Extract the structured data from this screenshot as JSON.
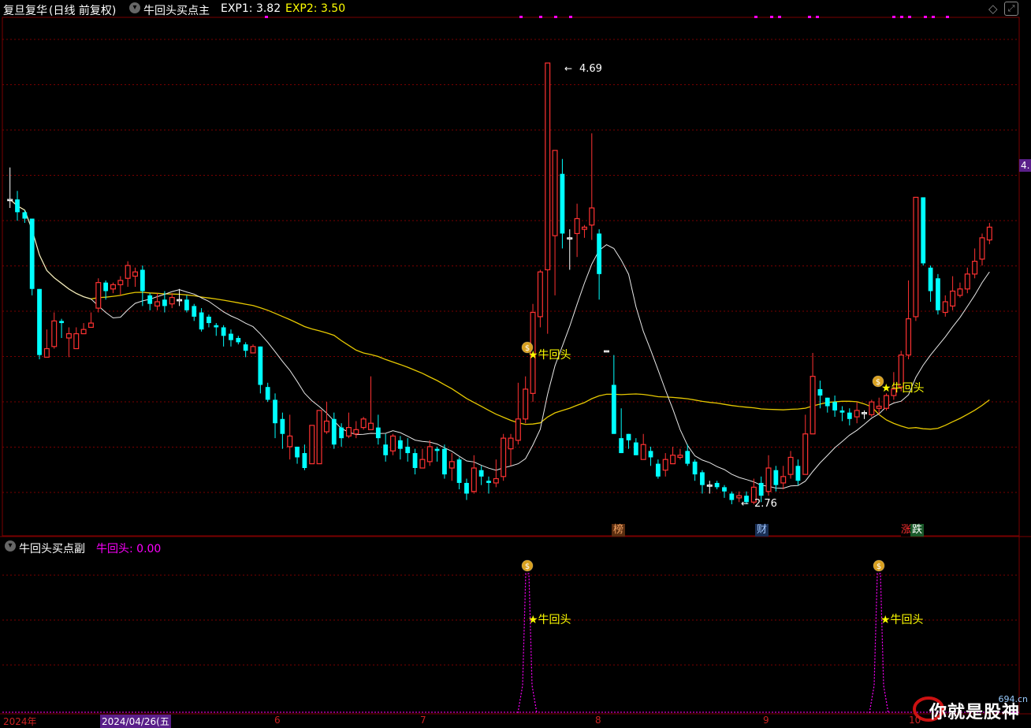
{
  "main_panel": {
    "stock_name": "复旦复华",
    "period_label": "(日线 前复权)",
    "indicator_name": "牛回头买点主",
    "exp1_label": "EXP1: 3.82",
    "exp2_label": "EXP2: 3.50",
    "price_tag": "4.",
    "high_label": "4.69",
    "low_label": "2.76",
    "signal_label": "★牛回头",
    "news_tags": [
      {
        "text": "榜",
        "color": "#d27a3c"
      },
      {
        "text": "财",
        "color": "#5a8ad8"
      },
      {
        "text": "涨",
        "color": "#cc2222"
      },
      {
        "text": "跌",
        "color": "#22aa44"
      }
    ]
  },
  "sub_panel": {
    "indicator_name": "牛回头买点副",
    "value_label": "牛回头: 0.00",
    "signal_label": "★牛回头"
  },
  "x_axis": {
    "labels": [
      "2024年",
      "2024/04/26(五",
      "6",
      "7",
      "8",
      "9",
      "10"
    ]
  },
  "watermark": {
    "text": "你就是股神",
    "site": "694.cn"
  },
  "colors": {
    "up": "#ff3232",
    "down": "#00ffff",
    "ma_short": "#e8e8e8",
    "ma_long": "#e6c800",
    "signal": "#ffff00",
    "magenta": "#ff00ff",
    "grid": "#7a0000"
  },
  "chart_data": {
    "type": "candlestick",
    "y_axis_visible": false,
    "price_high": 4.69,
    "price_low": 2.76,
    "series": [
      {
        "name": "EXP1",
        "last_value": 3.82
      },
      {
        "name": "EXP2",
        "last_value": 3.5
      }
    ],
    "ohlc": [
      [
        4.05,
        4.05,
        4.2,
        4.01
      ],
      [
        4.05,
        3.99,
        4.09,
        3.95
      ],
      [
        3.99,
        3.96,
        4.0,
        3.94
      ],
      [
        3.96,
        3.63,
        3.96,
        3.6
      ],
      [
        3.63,
        3.32,
        3.63,
        3.3
      ],
      [
        3.31,
        3.35,
        3.44,
        3.33
      ],
      [
        3.36,
        3.48,
        3.52,
        3.35
      ],
      [
        3.48,
        3.47,
        3.49,
        3.4
      ],
      [
        3.4,
        3.42,
        3.45,
        3.31
      ],
      [
        3.35,
        3.42,
        3.45,
        3.35
      ],
      [
        3.42,
        3.44,
        3.47,
        3.42
      ],
      [
        3.45,
        3.47,
        3.52,
        3.45
      ],
      [
        3.54,
        3.66,
        3.68,
        3.52
      ],
      [
        3.66,
        3.62,
        3.67,
        3.58
      ],
      [
        3.63,
        3.65,
        3.66,
        3.61
      ],
      [
        3.65,
        3.67,
        3.69,
        3.6
      ],
      [
        3.68,
        3.74,
        3.76,
        3.64
      ],
      [
        3.69,
        3.71,
        3.73,
        3.64
      ],
      [
        3.72,
        3.62,
        3.74,
        3.55
      ],
      [
        3.6,
        3.56,
        3.61,
        3.53
      ],
      [
        3.55,
        3.57,
        3.61,
        3.53
      ],
      [
        3.58,
        3.55,
        3.62,
        3.52
      ],
      [
        3.56,
        3.59,
        3.61,
        3.54
      ],
      [
        3.58,
        3.58,
        3.63,
        3.55
      ],
      [
        3.58,
        3.53,
        3.6,
        3.52
      ],
      [
        3.55,
        3.5,
        3.56,
        3.48
      ],
      [
        3.52,
        3.44,
        3.54,
        3.43
      ],
      [
        3.5,
        3.47,
        3.51,
        3.45
      ],
      [
        3.46,
        3.45,
        3.47,
        3.41
      ],
      [
        3.45,
        3.41,
        3.46,
        3.36
      ],
      [
        3.42,
        3.39,
        3.44,
        3.36
      ],
      [
        3.4,
        3.38,
        3.41,
        3.37
      ],
      [
        3.37,
        3.34,
        3.38,
        3.31
      ],
      [
        3.33,
        3.36,
        3.37,
        3.33
      ],
      [
        3.36,
        3.18,
        3.36,
        3.14
      ],
      [
        3.17,
        3.11,
        3.19,
        3.1
      ],
      [
        3.11,
        3.0,
        3.14,
        2.93
      ],
      [
        3.02,
        2.95,
        3.05,
        2.88
      ],
      [
        2.89,
        2.94,
        3.04,
        2.83
      ],
      [
        2.89,
        2.84,
        2.89,
        2.81
      ],
      [
        2.86,
        2.79,
        2.9,
        2.78
      ],
      [
        2.81,
        2.99,
        2.96,
        2.99
      ],
      [
        2.81,
        3.06,
        3.04,
        3.06
      ],
      [
        2.96,
        3.01,
        3.1,
        2.95
      ],
      [
        3.02,
        2.9,
        3.05,
        2.88
      ],
      [
        2.98,
        2.93,
        3.0,
        2.89
      ],
      [
        2.94,
        2.98,
        3.05,
        2.93
      ],
      [
        2.95,
        2.97,
        3.01,
        2.93
      ],
      [
        2.98,
        3.02,
        3.03,
        2.97
      ],
      [
        2.97,
        3.0,
        3.22,
        2.97
      ],
      [
        2.98,
        2.93,
        3.04,
        2.9
      ],
      [
        2.9,
        2.85,
        2.95,
        2.82
      ],
      [
        2.87,
        2.94,
        2.95,
        2.85
      ],
      [
        2.92,
        2.88,
        2.94,
        2.83
      ],
      [
        2.89,
        2.86,
        2.93,
        2.82
      ],
      [
        2.86,
        2.79,
        2.88,
        2.76
      ],
      [
        2.79,
        2.83,
        2.88,
        2.79
      ],
      [
        2.82,
        2.89,
        2.92,
        2.8
      ],
      [
        2.88,
        2.87,
        2.89,
        2.82
      ],
      [
        2.88,
        2.76,
        2.9,
        2.74
      ],
      [
        2.79,
        2.82,
        2.86,
        2.73
      ],
      [
        2.83,
        2.72,
        2.84,
        2.69
      ],
      [
        2.72,
        2.67,
        2.74,
        2.64
      ],
      [
        2.68,
        2.79,
        2.85,
        2.67
      ],
      [
        2.78,
        2.75,
        2.8,
        2.71
      ],
      [
        2.73,
        2.72,
        2.75,
        2.67
      ],
      [
        2.72,
        2.74,
        2.83,
        2.7
      ],
      [
        2.75,
        2.93,
        2.95,
        2.73
      ],
      [
        2.88,
        2.93,
        2.95,
        2.8
      ],
      [
        2.92,
        3.02,
        3.19,
        2.9
      ],
      [
        3.02,
        3.16,
        3.22,
        3.0
      ],
      [
        3.14,
        3.52,
        3.56,
        3.1
      ],
      [
        3.5,
        3.71,
        3.72,
        3.45
      ],
      [
        3.72,
        4.69,
        4.69,
        3.42
      ],
      [
        3.88,
        4.28,
        4.28,
        3.6
      ],
      [
        4.17,
        3.89,
        4.24,
        3.82
      ],
      [
        3.87,
        3.87,
        3.91,
        3.72
      ],
      [
        3.89,
        3.96,
        4.03,
        3.78
      ],
      [
        3.91,
        3.92,
        3.93,
        3.87
      ],
      [
        3.93,
        4.01,
        4.36,
        3.86
      ],
      [
        3.89,
        3.7,
        3.91,
        3.58
      ],
      [
        3.34,
        3.34,
        3.34,
        3.34
      ],
      [
        3.18,
        2.95,
        3.32,
        2.95
      ],
      [
        2.93,
        2.86,
        3.07,
        2.86
      ],
      [
        2.95,
        2.92,
        2.95,
        2.88
      ],
      [
        2.91,
        2.85,
        2.93,
        2.85
      ],
      [
        2.83,
        2.9,
        2.95,
        2.83
      ],
      [
        2.87,
        2.84,
        2.89,
        2.8
      ],
      [
        2.81,
        2.75,
        2.83,
        2.74
      ],
      [
        2.78,
        2.83,
        2.86,
        2.75
      ],
      [
        2.81,
        2.85,
        2.89,
        2.81
      ],
      [
        2.84,
        2.85,
        2.88,
        2.83
      ],
      [
        2.87,
        2.81,
        2.9,
        2.8
      ],
      [
        2.82,
        2.76,
        2.83,
        2.73
      ],
      [
        2.77,
        2.71,
        2.78,
        2.67
      ],
      [
        2.71,
        2.71,
        2.73,
        2.67
      ],
      [
        2.72,
        2.7,
        2.73,
        2.69
      ],
      [
        2.7,
        2.68,
        2.71,
        2.65
      ],
      [
        2.67,
        2.64,
        2.68,
        2.62
      ],
      [
        2.65,
        2.66,
        2.68,
        2.63
      ],
      [
        2.66,
        2.63,
        2.68,
        2.62
      ],
      [
        2.63,
        2.7,
        2.74,
        2.62
      ],
      [
        2.72,
        2.66,
        2.75,
        2.63
      ],
      [
        2.68,
        2.79,
        2.85,
        2.66
      ],
      [
        2.78,
        2.71,
        2.8,
        2.68
      ],
      [
        2.72,
        2.75,
        2.8,
        2.69
      ],
      [
        2.76,
        2.84,
        2.87,
        2.74
      ],
      [
        2.8,
        2.73,
        2.83,
        2.71
      ],
      [
        2.76,
        2.95,
        3.04,
        2.76
      ],
      [
        2.95,
        3.22,
        3.33,
        2.95
      ],
      [
        3.16,
        3.13,
        3.2,
        3.07
      ],
      [
        3.12,
        3.08,
        3.12,
        3.05
      ],
      [
        3.1,
        3.06,
        3.13,
        3.03
      ],
      [
        3.06,
        3.05,
        3.08,
        3.01
      ],
      [
        3.05,
        3.02,
        3.07,
        2.99
      ],
      [
        3.03,
        3.06,
        3.1,
        3.0
      ],
      [
        3.05,
        3.05,
        3.06,
        3.02
      ],
      [
        3.04,
        3.1,
        3.11,
        3.03
      ],
      [
        3.07,
        3.08,
        3.12,
        3.04
      ],
      [
        3.07,
        3.13,
        3.14,
        3.06
      ],
      [
        3.13,
        3.16,
        3.24,
        3.11
      ],
      [
        3.17,
        3.32,
        3.34,
        3.15
      ],
      [
        3.32,
        3.49,
        3.67,
        3.3
      ],
      [
        3.5,
        4.06,
        4.06,
        3.48
      ],
      [
        4.06,
        3.75,
        4.06,
        3.74
      ],
      [
        3.73,
        3.62,
        3.74,
        3.57
      ],
      [
        3.68,
        3.53,
        3.7,
        3.51
      ],
      [
        3.52,
        3.57,
        3.6,
        3.5
      ],
      [
        3.55,
        3.62,
        3.69,
        3.53
      ],
      [
        3.6,
        3.63,
        3.66,
        3.59
      ],
      [
        3.63,
        3.7,
        3.73,
        3.61
      ],
      [
        3.7,
        3.76,
        3.82,
        3.68
      ],
      [
        3.77,
        3.87,
        3.89,
        3.74
      ],
      [
        3.86,
        3.92,
        3.94,
        3.84
      ]
    ]
  }
}
